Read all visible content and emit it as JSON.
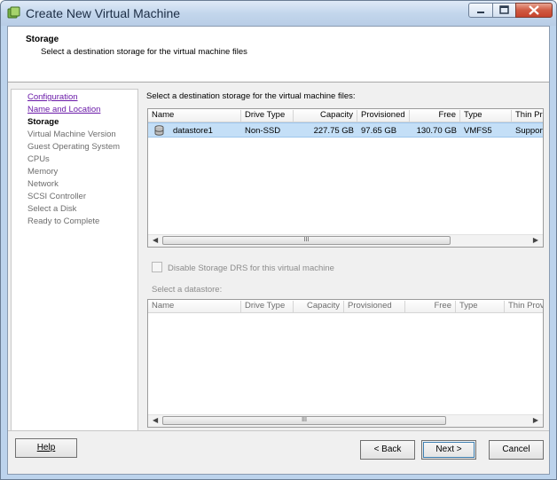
{
  "window": {
    "title": "Create New Virtual Machine"
  },
  "header": {
    "title": "Storage",
    "subtitle": "Select a destination storage for the virtual machine files"
  },
  "sidebar": {
    "items": [
      {
        "label": "Configuration",
        "state": "link"
      },
      {
        "label": "Name and Location",
        "state": "link"
      },
      {
        "label": "Storage",
        "state": "current"
      },
      {
        "label": "Virtual Machine Version",
        "state": "pending"
      },
      {
        "label": "Guest Operating System",
        "state": "pending"
      },
      {
        "label": "CPUs",
        "state": "pending"
      },
      {
        "label": "Memory",
        "state": "pending"
      },
      {
        "label": "Network",
        "state": "pending"
      },
      {
        "label": "SCSI Controller",
        "state": "pending"
      },
      {
        "label": "Select a Disk",
        "state": "pending"
      },
      {
        "label": "Ready to Complete",
        "state": "pending"
      }
    ]
  },
  "main": {
    "label": "Select a destination storage for the virtual machine files:",
    "columns": [
      "Name",
      "Drive Type",
      "Capacity",
      "Provisioned",
      "Free",
      "Type",
      "Thin Pro"
    ],
    "rows": [
      {
        "name": "datastore1",
        "drive_type": "Non-SSD",
        "capacity": "227.75 GB",
        "provisioned": "97.65 GB",
        "free": "130.70 GB",
        "type": "VMFS5",
        "thin": "Support"
      }
    ],
    "scroll_grip": "III",
    "drs_checkbox": {
      "label": "Disable Storage DRS for this virtual machine",
      "checked": false
    },
    "select_datastore_label": "Select a datastore:",
    "columns2": [
      "Name",
      "Drive Type",
      "Capacity",
      "Provisioned",
      "Free",
      "Type",
      "Thin Prov"
    ]
  },
  "buttons": {
    "help": "Help",
    "back": "< Back",
    "next": "Next >",
    "cancel": "Cancel"
  },
  "icons": [
    "app-icon",
    "minimize-icon",
    "maximize-icon",
    "close-icon",
    "datastore-icon",
    "scroll-left-icon",
    "scroll-right-icon"
  ],
  "colors": {
    "selection": "#c4dff7",
    "link": "#6a1aa8",
    "close_button": "#c7432c"
  }
}
